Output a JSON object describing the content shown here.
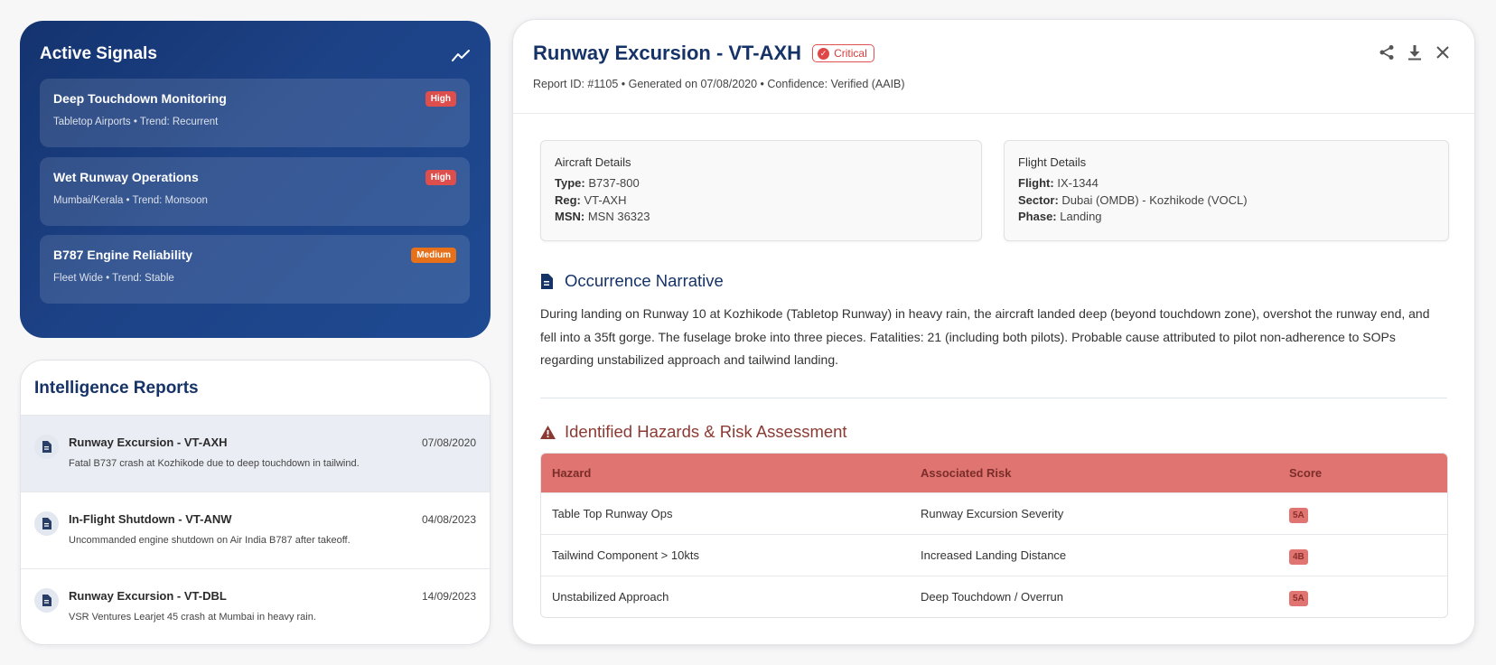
{
  "signals": {
    "title": "Active Signals",
    "items": [
      {
        "title": "Deep Touchdown Monitoring",
        "sub": "Tabletop Airports • Trend: Recurrent",
        "badge": "High"
      },
      {
        "title": "Wet Runway Operations",
        "sub": "Mumbai/Kerala • Trend: Monsoon",
        "badge": "High"
      },
      {
        "title": "B787 Engine Reliability",
        "sub": "Fleet Wide • Trend: Stable",
        "badge": "Medium"
      }
    ]
  },
  "reports": {
    "title": "Intelligence Reports",
    "items": [
      {
        "title": "Runway Excursion - VT-AXH",
        "date": "07/08/2020",
        "sub": "Fatal B737 crash at Kozhikode due to deep touchdown in tailwind."
      },
      {
        "title": "In-Flight Shutdown - VT-ANW",
        "date": "04/08/2023",
        "sub": "Uncommanded engine shutdown on Air India B787 after takeoff."
      },
      {
        "title": "Runway Excursion - VT-DBL",
        "date": "14/09/2023",
        "sub": "VSR Ventures Learjet 45 crash at Mumbai in heavy rain."
      }
    ]
  },
  "detail": {
    "title": "Runway Excursion - VT-AXH",
    "severity": "Critical",
    "meta": "Report ID: #1105 • Generated on 07/08/2020 • Confidence: Verified (AAIB)",
    "aircraft": {
      "heading": "Aircraft Details",
      "type_label": "Type:",
      "type": "B737-800",
      "reg_label": "Reg:",
      "reg": "VT-AXH",
      "msn_label": "MSN:",
      "msn": "MSN 36323"
    },
    "flight": {
      "heading": "Flight Details",
      "flight_label": "Flight:",
      "flight": "IX-1344",
      "sector_label": "Sector:",
      "sector": "Dubai (OMDB) - Kozhikode (VOCL)",
      "phase_label": "Phase:",
      "phase": "Landing"
    },
    "narrative_title": "Occurrence Narrative",
    "narrative": "During landing on Runway 10 at Kozhikode (Tabletop Runway) in heavy rain, the aircraft landed deep (beyond touchdown zone), overshot the runway end, and fell into a 35ft gorge. The fuselage broke into three pieces. Fatalities: 21 (including both pilots). Probable cause attributed to pilot non-adherence to SOPs regarding unstabilized approach and tailwind landing.",
    "hazards_title": "Identified Hazards & Risk Assessment",
    "table": {
      "headers": [
        "Hazard",
        "Associated Risk",
        "Score"
      ],
      "rows": [
        {
          "hazard": "Table Top Runway Ops",
          "risk": "Runway Excursion Severity",
          "score": "5A"
        },
        {
          "hazard": "Tailwind Component > 10kts",
          "risk": "Increased Landing Distance",
          "score": "4B"
        },
        {
          "hazard": "Unstabilized Approach",
          "risk": "Deep Touchdown / Overrun",
          "score": "5A"
        }
      ]
    }
  },
  "colors": {
    "navy": "#163368",
    "high": "#dd4e4c",
    "medium": "#e7711b",
    "hazard_header": "#e07470"
  }
}
